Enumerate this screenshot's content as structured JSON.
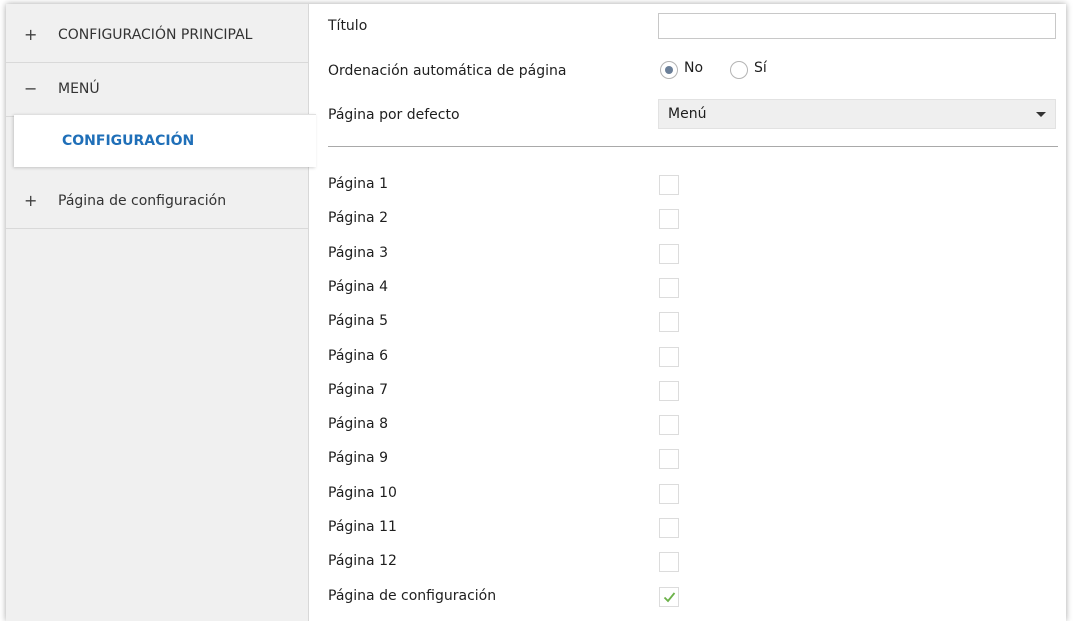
{
  "sidebar": {
    "items": [
      {
        "sign": "+",
        "label": "CONFIGURACIÓN PRINCIPAL"
      },
      {
        "sign": "−",
        "label": "MENÚ"
      },
      {
        "sign": "+",
        "label": "Página de configuración"
      }
    ],
    "active_sub": {
      "label": "CONFIGURACIÓN"
    }
  },
  "main": {
    "title": {
      "label": "Título",
      "value": ""
    },
    "auto_order": {
      "label": "Ordenación automática de página",
      "options": [
        {
          "label": "No",
          "checked": true
        },
        {
          "label": "Sí",
          "checked": false
        }
      ]
    },
    "default_page": {
      "label": "Página por defecto",
      "value": "Menú"
    },
    "pages": [
      {
        "label": "Página 1",
        "checked": false
      },
      {
        "label": "Página 2",
        "checked": false
      },
      {
        "label": "Página 3",
        "checked": false
      },
      {
        "label": "Página 4",
        "checked": false
      },
      {
        "label": "Página 5",
        "checked": false
      },
      {
        "label": "Página 6",
        "checked": false
      },
      {
        "label": "Página 7",
        "checked": false
      },
      {
        "label": "Página 8",
        "checked": false
      },
      {
        "label": "Página 9",
        "checked": false
      },
      {
        "label": "Página 10",
        "checked": false
      },
      {
        "label": "Página 11",
        "checked": false
      },
      {
        "label": "Página 12",
        "checked": false
      },
      {
        "label": "Página de configuración",
        "checked": true
      }
    ]
  },
  "colors": {
    "accent": "#1f6fb8",
    "check": "#6cb24a"
  },
  "icons": {
    "expand": "plus-icon",
    "collapse": "minus-icon",
    "check": "checkmark-icon",
    "dropdown": "caret-down-icon"
  }
}
